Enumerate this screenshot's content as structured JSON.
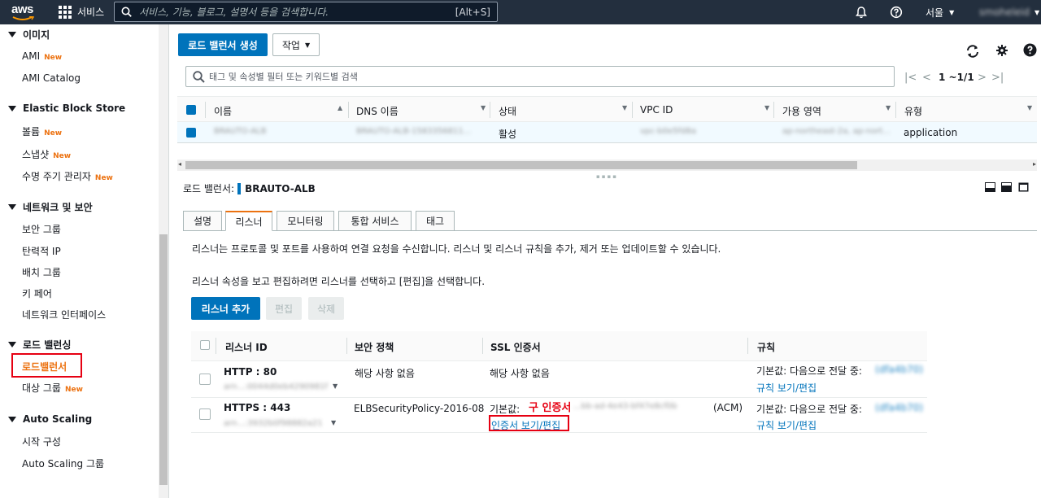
{
  "topnav": {
    "logo": "aws",
    "services_label": "서비스",
    "search_placeholder": "서비스, 기능, 블로그, 설명서 등을 검색합니다.",
    "search_shortcut": "[Alt+S]",
    "region": "서울",
    "account": "smoheleid"
  },
  "sidebar": {
    "sections": [
      {
        "title": "이미지",
        "items": [
          {
            "label": "AMI",
            "badge": "New"
          },
          {
            "label": "AMI Catalog",
            "badge": ""
          }
        ]
      },
      {
        "title": "Elastic Block Store",
        "items": [
          {
            "label": "볼륨",
            "badge": "New"
          },
          {
            "label": "스냅샷",
            "badge": "New"
          },
          {
            "label": "수명 주기 관리자",
            "badge": "New"
          }
        ]
      },
      {
        "title": "네트워크 및 보안",
        "items": [
          {
            "label": "보안 그룹",
            "badge": ""
          },
          {
            "label": "탄력적 IP",
            "badge": ""
          },
          {
            "label": "배치 그룹",
            "badge": ""
          },
          {
            "label": "키 페어",
            "badge": ""
          },
          {
            "label": "네트워크 인터페이스",
            "badge": ""
          }
        ]
      },
      {
        "title": "로드 밸런싱",
        "items": [
          {
            "label": "로드밸런서",
            "badge": ""
          },
          {
            "label": "대상 그룹",
            "badge": "New"
          }
        ]
      },
      {
        "title": "Auto Scaling",
        "items": [
          {
            "label": "시작 구성",
            "badge": ""
          },
          {
            "label": "Auto Scaling 그룹",
            "badge": ""
          }
        ]
      }
    ]
  },
  "toolbar": {
    "create_label": "로드 밸런서 생성",
    "actions_label": "작업"
  },
  "filter": {
    "placeholder": "태그 및 속성별 필터 또는 키워드별 검색"
  },
  "pager": {
    "text": "1 ~1/1"
  },
  "table": {
    "headers": [
      "이름",
      "DNS 이름",
      "상태",
      "VPC ID",
      "가용 영역",
      "유형"
    ],
    "row": {
      "name": "BRAUTO-ALB",
      "dns": "BRAUTO-ALB-1583356811...",
      "state": "활성",
      "vpc": "vpc-b0e5fd8a",
      "az": "ap-northeast-2a, ap-nort...",
      "type": "application"
    }
  },
  "detail": {
    "label": "로드 밸런서:",
    "name": "BRAUTO-ALB",
    "tabs": [
      "설명",
      "리스너",
      "모니터링",
      "통합 서비스",
      "태그"
    ],
    "active_tab": "리스너",
    "desc1": "리스너는 프로토콜 및 포트를 사용하여 연결 요청을 수신합니다. 리스너 및 리스너 규칙을 추가, 제거 또는 업데이트할 수 있습니다.",
    "desc2": "리스너 속성을 보고 편집하려면 리스너를 선택하고 [편집]을 선택합니다.",
    "add_listener": "리스너 추가",
    "edit": "편집",
    "delete": "삭제"
  },
  "listeners": {
    "headers": [
      "리스너 ID",
      "보안 정책",
      "SSL 인증서",
      "규칙"
    ],
    "rows": [
      {
        "id": "HTTP : 80",
        "arn": "arn...:0044d0eb4290981f",
        "policy": "해당 사항 없음",
        "ssl": "해당 사항 없음",
        "rule_prefix": "기본값:  다음으로 전달 중:",
        "rule_target": "(dfa4b70)",
        "rule_link": "규칙 보기/편집",
        "cert_prefix": "",
        "cert_value": "",
        "cert_suffix": "",
        "cert_link": "",
        "annotation": ""
      },
      {
        "id": "HTTPS : 443",
        "arn": "arn...:3932b0f98882a21",
        "policy": "ELBSecurityPolicy-2016-08",
        "ssl": "",
        "rule_prefix": "기본값:  다음으로 전달 중:",
        "rule_target": "(dfa4b70)",
        "rule_link": "규칙 보기/편집",
        "cert_prefix": "기본값:",
        "cert_value": "...bb-ad-4e43-bf47e8cf0b",
        "cert_suffix": "(ACM)",
        "cert_link": "인증서 보기/편집",
        "annotation": "구 인증서"
      }
    ]
  },
  "colors": {
    "nav_bg": "#232f3e",
    "primary": "#0073bb",
    "accent": "#ec7211",
    "highlight": "#e60012"
  }
}
